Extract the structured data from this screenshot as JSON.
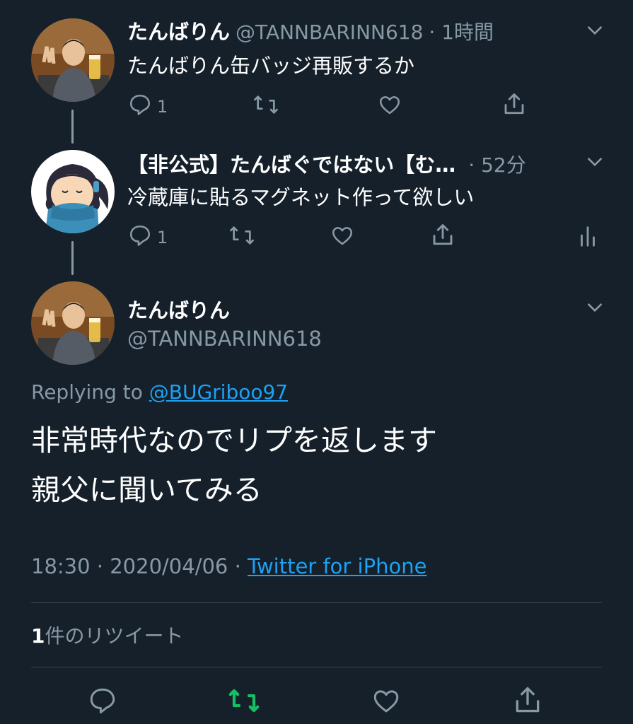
{
  "tweets": [
    {
      "name": "たんばりん",
      "handle": "@TANNBARINN618",
      "time": "· 1時間",
      "text": "たんばりん缶バッジ再販するか",
      "reply_count": "1"
    },
    {
      "name": "【非公式】たんばぐではない【む…",
      "time": "· 52分",
      "text": "冷蔵庫に貼るマグネット作って欲しい",
      "reply_count": "1"
    }
  ],
  "main": {
    "name": "たんばりん",
    "handle": "@TANNBARINN618",
    "replying_prefix": "Replying to",
    "replying_handle": "@BUGriboo97",
    "text_line1": "非常時代なのでリプを返します",
    "text_line2": "親父に聞いてみる",
    "timestamp": "18:30 · 2020/04/06 ·",
    "source": "Twitter for iPhone",
    "retweet_count": "1",
    "retweet_label": "件のリツイート"
  },
  "colors": {
    "background": "#15202b",
    "muted": "#8899a6",
    "link": "#1da1f2",
    "retweet_active": "#17bf63"
  },
  "icons": [
    "reply-icon",
    "retweet-icon",
    "like-icon",
    "share-icon",
    "analytics-icon",
    "chevron-down-icon"
  ]
}
